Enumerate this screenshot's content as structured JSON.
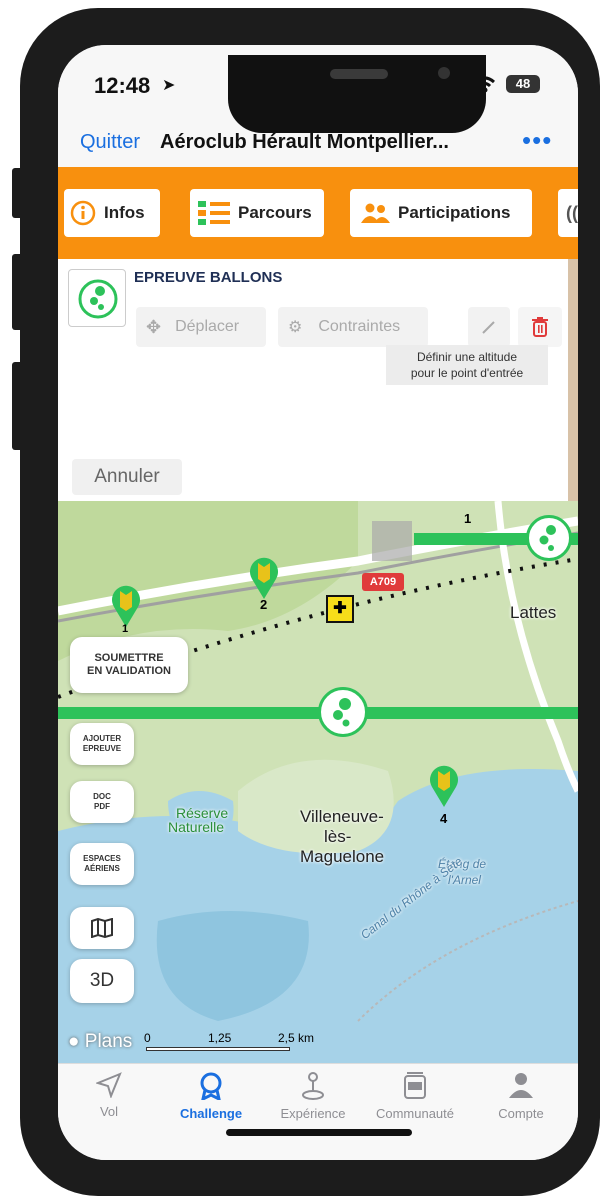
{
  "status_bar": {
    "time": "12:48",
    "battery": "48"
  },
  "nav": {
    "quit_label": "Quitter",
    "title": "Aéroclub Hérault Montpellier...",
    "more_label": "•••"
  },
  "tabs": [
    {
      "label": "Infos",
      "icon": "info-circle-icon"
    },
    {
      "label": "Parcours",
      "icon": "list-icon"
    },
    {
      "label": "Participations",
      "icon": "people-icon"
    }
  ],
  "panel": {
    "event_title": "EPREUVE BALLONS",
    "move_label": "Déplacer",
    "constraints_label": "Contraintes",
    "tooltip_line1": "Définir une altitude",
    "tooltip_line2": "pour le point d'entrée",
    "cancel_label": "Annuler"
  },
  "map": {
    "road_label": "A709",
    "places": {
      "lattes": "Lattes",
      "villeneuve_1": "Villeneuve-",
      "villeneuve_2": "lès-",
      "villeneuve_3": "Maguelone",
      "reserve_1": "Réserve",
      "reserve_2": "Naturelle",
      "etang_1": "Étang de",
      "etang_2": "l'Arnel",
      "canal": "Canal du Rhône à Sète"
    },
    "markers": [
      "1",
      "2",
      "1",
      "4"
    ],
    "buttons": {
      "submit_line1": "SOUMETTRE",
      "submit_line2": "EN VALIDATION",
      "add_line1": "AJOUTER",
      "add_line2": "EPREUVE",
      "doc_line1": "DOC",
      "doc_line2": "PDF",
      "airspace_line1": "ESPACES",
      "airspace_line2": "AÉRIENS",
      "three_d": "3D"
    },
    "attribution": "Plans",
    "scale": {
      "s0": "0",
      "s1": "1,25",
      "s2": "2,5 km"
    }
  },
  "bottom_tabs": [
    {
      "label": "Vol",
      "icon": "plane-arrow-icon",
      "active": false
    },
    {
      "label": "Challenge",
      "icon": "ribbon-icon",
      "active": true
    },
    {
      "label": "Expérience",
      "icon": "joystick-icon",
      "active": false
    },
    {
      "label": "Communauté",
      "icon": "community-icon",
      "active": false
    },
    {
      "label": "Compte",
      "icon": "person-icon",
      "active": false
    }
  ],
  "colors": {
    "accent": "#f8900e",
    "link": "#1a6fe0",
    "route": "#2dc25a",
    "danger": "#e03b3b"
  }
}
